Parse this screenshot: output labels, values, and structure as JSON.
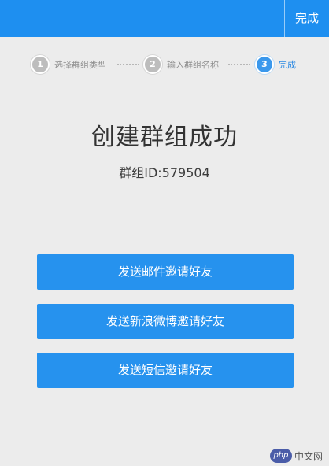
{
  "app_bar": {
    "done_label": "完成"
  },
  "stepper": {
    "steps": [
      {
        "number": "1",
        "label": "选择群组类型",
        "state": "done"
      },
      {
        "number": "2",
        "label": "输入群组名称",
        "state": "done"
      },
      {
        "number": "3",
        "label": "完成",
        "state": "active"
      }
    ]
  },
  "main": {
    "title": "创建群组成功",
    "group_id": "群组ID:579504"
  },
  "actions": {
    "email_invite": "发送邮件邀请好友",
    "weibo_invite": "发送新浪微博邀请好友",
    "sms_invite": "发送短信邀请好友"
  },
  "watermark": {
    "logo_text": "php",
    "site_text": "中文网"
  },
  "colors": {
    "primary": "#1e8ff0",
    "button": "#2692ee",
    "background": "#ececec",
    "step_inactive": "#bdbdbd",
    "step_active": "#3a98ec"
  }
}
